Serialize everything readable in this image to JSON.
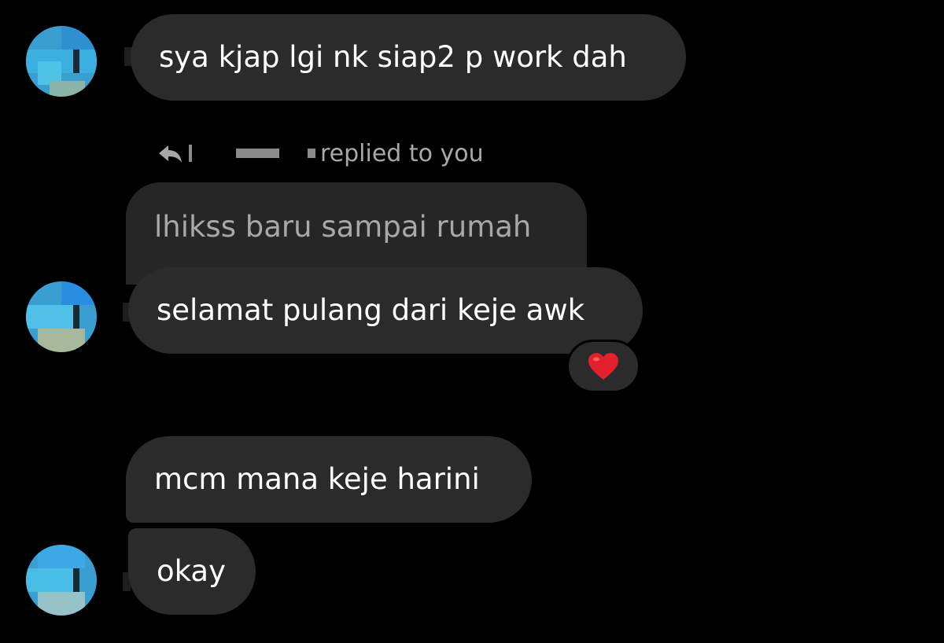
{
  "messages": [
    {
      "text": "sya kjap lgi nk siap2 p work dah"
    },
    {
      "text": "selamat pulang dari keje awk"
    },
    {
      "text": "mcm mana keje harini"
    },
    {
      "text": "okay"
    }
  ],
  "reply": {
    "header_text": "replied to you",
    "quoted_text": "lhikss baru sampai rumah",
    "icon": "reply-arrow-icon"
  },
  "reaction": {
    "emoji": "heart-icon",
    "color": "#e3202b"
  },
  "colors": {
    "background": "#000000",
    "bubble": "#2b2b2b",
    "quoted_bubble": "#262626",
    "text": "#ffffff",
    "muted_text": "#a8a8a8"
  }
}
